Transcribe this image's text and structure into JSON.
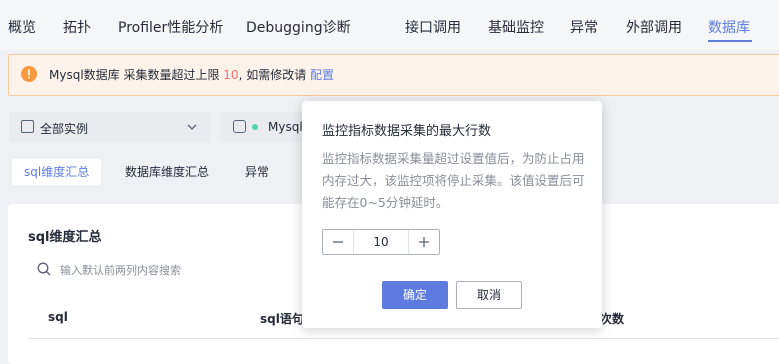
{
  "nav": {
    "items": [
      {
        "label": "概览",
        "active": false
      },
      {
        "label": "拓扑",
        "active": false
      },
      {
        "label": "Profiler性能分析",
        "active": false
      },
      {
        "label": "Debugging诊断",
        "active": false
      },
      {
        "label": "接口调用",
        "active": false
      },
      {
        "label": "基础监控",
        "active": false
      },
      {
        "label": "异常",
        "active": false
      },
      {
        "label": "外部调用",
        "active": false
      },
      {
        "label": "数据库",
        "active": true
      }
    ]
  },
  "alert": {
    "text_before": "Mysql数据库 采集数量超过上限 ",
    "limit": "10",
    "text_after": ", 如需修改请 ",
    "link": "配置"
  },
  "filters": {
    "instance_select": "全部实例",
    "db_select": "Mysql"
  },
  "subtabs": [
    "sql维度汇总",
    "数据库维度汇总",
    "异常"
  ],
  "card": {
    "title": "sql维度汇总",
    "search_placeholder": "输入默认前两列内容搜索",
    "columns": [
      "sql",
      "sql语句",
      "次数"
    ]
  },
  "popover": {
    "title": "监控指标数据采集的最大行数",
    "description": "监控指标数据采集量超过设置值后，为防止占用内存过大，该监控项将停止采集。该值设置后可能存在0~5分钟延时。",
    "value": "10",
    "confirm": "确定",
    "cancel": "取消"
  },
  "colors": {
    "accent": "#5e7ce0",
    "warning": "#fa9841",
    "danger": "#f66f6a"
  }
}
